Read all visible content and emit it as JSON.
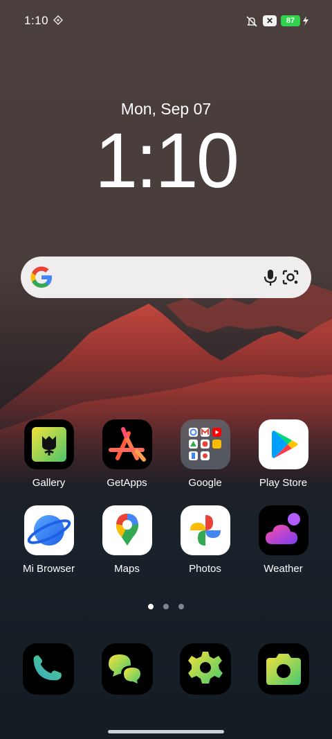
{
  "status_bar": {
    "time": "1:10",
    "x_badge": "✕",
    "battery_level": "87",
    "icons": [
      "diamond-icon",
      "mute-icon",
      "battery-icon",
      "charging-icon"
    ]
  },
  "lockscreen": {
    "date": "Mon, Sep 07",
    "clock": "1:10"
  },
  "search": {
    "icons": [
      "google-g-icon",
      "microphone-icon",
      "camera-lens-icon"
    ]
  },
  "apps": [
    {
      "label": "Gallery",
      "icon": "gallery-icon"
    },
    {
      "label": "GetApps",
      "icon": "getapps-icon"
    },
    {
      "label": "Google",
      "icon": "google-folder-icon"
    },
    {
      "label": "Play Store",
      "icon": "play-store-icon"
    },
    {
      "label": "Mi Browser",
      "icon": "mi-browser-icon"
    },
    {
      "label": "Maps",
      "icon": "maps-icon"
    },
    {
      "label": "Photos",
      "icon": "photos-icon"
    },
    {
      "label": "Weather",
      "icon": "weather-icon"
    }
  ],
  "page_indicator": {
    "pages": 3,
    "active": 1
  },
  "dock": [
    "phone-icon",
    "messaging-icon",
    "settings-icon",
    "camera-icon"
  ]
}
